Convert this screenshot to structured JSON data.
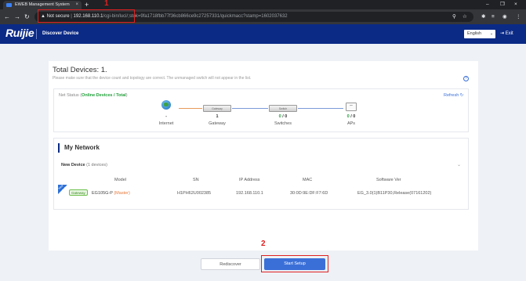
{
  "browser": {
    "tab_title": "EWEB Management System",
    "tab_close": "×",
    "new_tab": "+",
    "window_controls": [
      "–",
      "❐",
      "×"
    ],
    "address": {
      "warning": "▲ Not secure",
      "host": "192.168.110.1",
      "path": "/cgi-bin/luci/;stok=9fa1718fbb77f36cb866ce9c27257331/quickmacc?stamp=1602037632"
    }
  },
  "annotations": {
    "step1": "1",
    "step2": "2"
  },
  "header": {
    "logo": "Ruijie",
    "title": "Discover Device",
    "language": "English",
    "exit_label": "Exit"
  },
  "summary": {
    "title": "Total Devices: 1.",
    "hint": "Please make sure that the device count and topology are correct. The unmanaged switch will not appear in the list."
  },
  "net_status": {
    "label_prefix": "Net Status (",
    "label_highlight": "Online Devices / Total",
    "label_suffix": ")",
    "refresh": "Refresh",
    "nodes": [
      {
        "count": "-",
        "name": "Internet"
      },
      {
        "count": "1",
        "name": "Gateway",
        "device_text": "Gateway"
      },
      {
        "online": "0",
        "total": " / 0",
        "name": "Switches",
        "device_text": "Switch"
      },
      {
        "online": "0",
        "total": " / 0",
        "name": "APs"
      }
    ]
  },
  "my_network": {
    "title": "My Network",
    "new_device_label": "New Device",
    "new_device_count": "(1 devices)",
    "columns": [
      "Model",
      "SN",
      "IP Address",
      "MAC",
      "Software Ver"
    ],
    "rows": [
      {
        "badge": "New",
        "tag": "Gateway",
        "model": "EG105G-P",
        "role": "(Master)",
        "sn": "H1PH62U002385",
        "ip": "192.168.110.1",
        "mac": "30:0D:9E:DF:F7:6D",
        "software": "EG_3.0(1)B11P30,Release(07161202)"
      }
    ]
  },
  "buttons": {
    "rediscover": "Rediscover",
    "start_setup": "Start Setup"
  },
  "colors": {
    "header_bg": "#0b2a86",
    "accent": "#3a6fd8",
    "online_green": "#21a03a",
    "annotation_red": "#e02020"
  }
}
